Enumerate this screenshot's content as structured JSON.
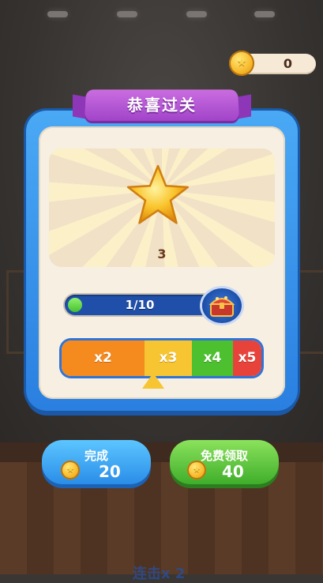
{
  "coins": {
    "value": "0"
  },
  "dialog": {
    "title": "恭喜过关",
    "star_count": "3",
    "progress": {
      "text": "1/10",
      "fraction": 0.1
    },
    "multipliers": [
      {
        "label": "x2",
        "color": "#f58a1f"
      },
      {
        "label": "x3",
        "color": "#f7c531"
      },
      {
        "label": "x4",
        "color": "#4cc02f"
      },
      {
        "label": "x5",
        "color": "#e8433b"
      }
    ]
  },
  "buttons": {
    "complete": {
      "label": "完成",
      "amount": "20"
    },
    "free_claim": {
      "label": "免费领取",
      "amount": "40"
    }
  },
  "combo": {
    "text": "连击x 2"
  }
}
